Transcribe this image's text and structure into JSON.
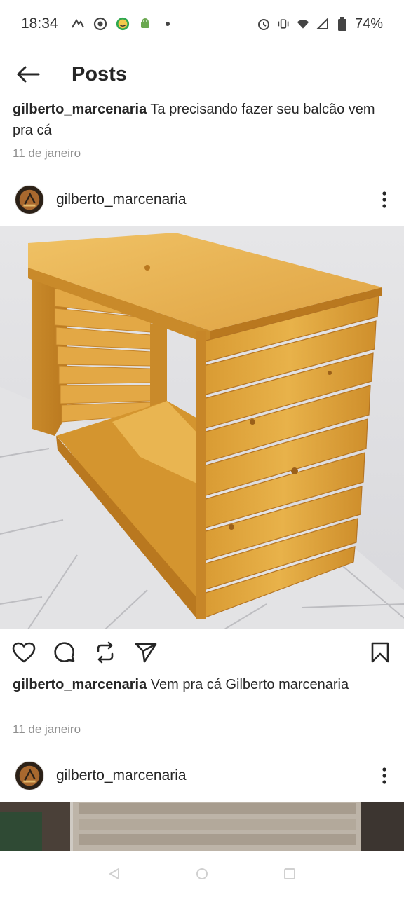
{
  "status": {
    "time": "18:34",
    "battery": "74%"
  },
  "header": {
    "title": "Posts"
  },
  "first_caption": {
    "username": "gilberto_marcenaria",
    "text": "Ta precisando fazer seu balcão vem pra cá",
    "date": "11 de janeiro"
  },
  "post": {
    "username": "gilberto_marcenaria",
    "avatar_text": "GILBERTO MARCENARIA",
    "caption_username": "gilberto_marcenaria",
    "caption_text": "Vem pra cá Gilberto marcenaria",
    "date": "11 de janeiro"
  },
  "next_post": {
    "username": "gilberto_marcenaria"
  },
  "icons": {
    "back": "arrow-left-icon",
    "more": "more-vertical-icon",
    "like": "heart-icon",
    "comment": "comment-icon",
    "repost": "repost-icon",
    "share": "send-icon",
    "save": "bookmark-icon"
  },
  "colors": {
    "text": "#262626",
    "muted": "#8e8e8e",
    "wood": "#d9a441"
  }
}
